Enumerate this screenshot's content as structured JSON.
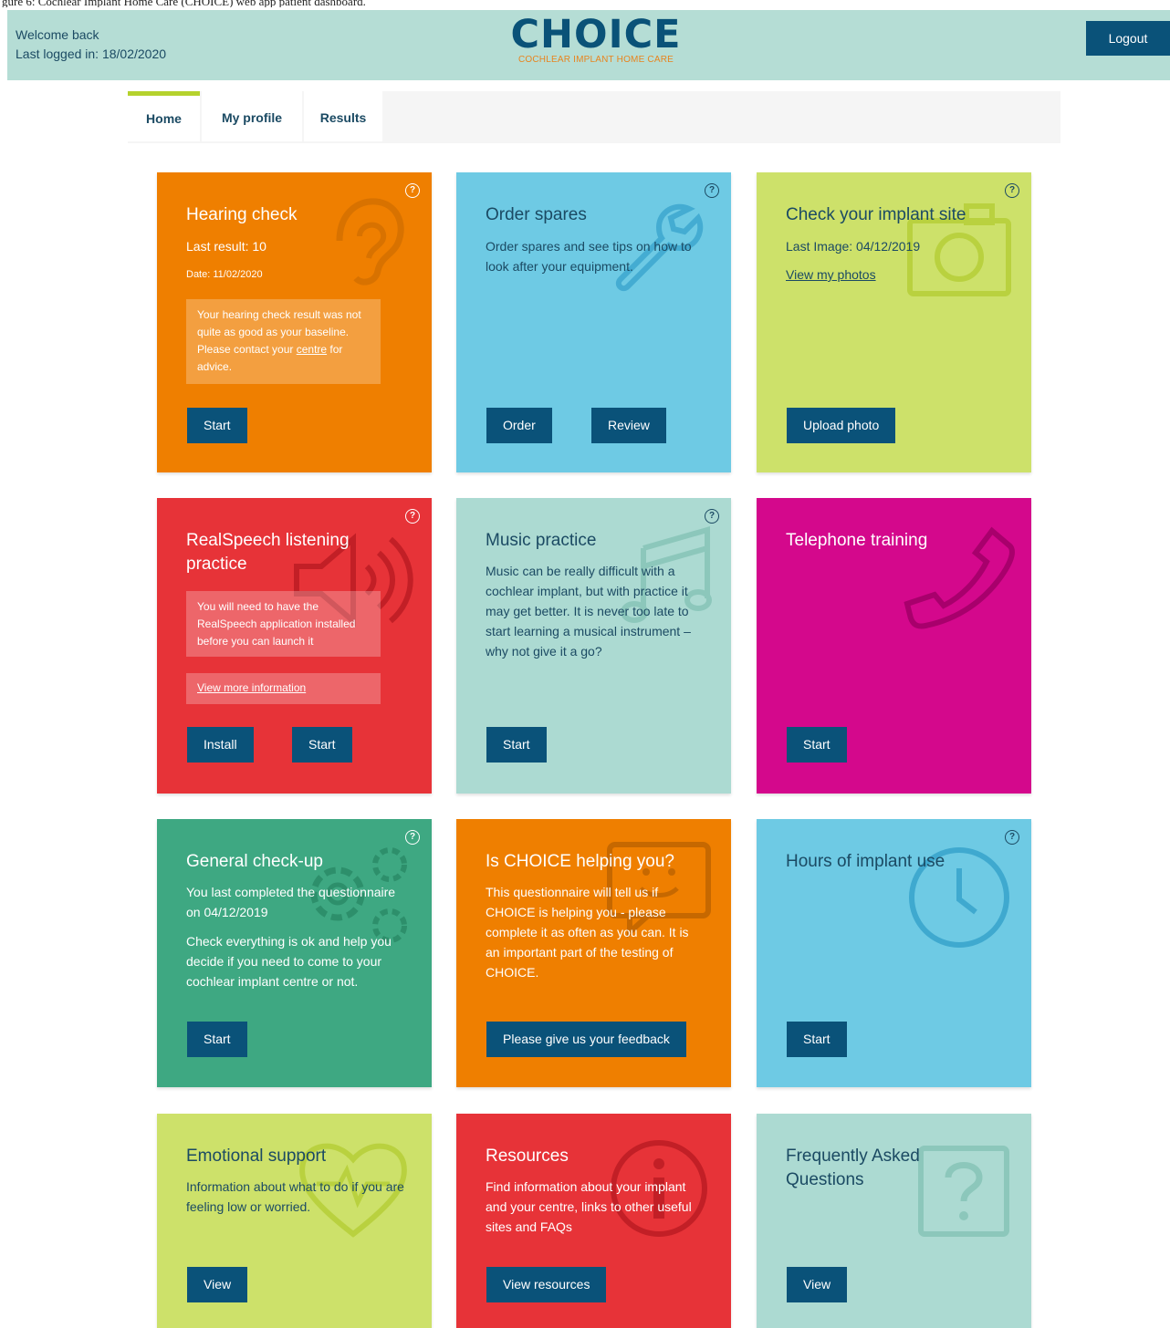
{
  "top_caption": "gure 6: Cochlear Implant Home Care (CHOICE) web app patient dashboard.",
  "header": {
    "welcome": "Welcome back",
    "last_login": "Last logged in: 18/02/2020",
    "logo_word": "CHOICE",
    "logo_sub": "COCHLEAR IMPLANT HOME CARE",
    "logout": "Logout"
  },
  "tabs": [
    {
      "label": "Home",
      "active": true
    },
    {
      "label": "My profile",
      "active": false
    },
    {
      "label": "Results",
      "active": false
    }
  ],
  "colors": {
    "orange": "#ef7f00",
    "sky": "#6ecae4",
    "lime": "#cde16a",
    "red": "#e73338",
    "mint": "#acdad2",
    "magenta": "#d4088c",
    "green": "#3ea882",
    "navy_button": "#0a5279"
  },
  "cards": {
    "hearing": {
      "title": "Hearing check",
      "last_result": "Last result: 10",
      "date": "Date: 11/02/2020",
      "note_pre": "Your hearing check result was not quite as good as your baseline. Please contact your ",
      "note_link": "centre",
      "note_post": " for advice.",
      "start": "Start",
      "icon": "ear-icon"
    },
    "spares": {
      "title": "Order spares",
      "text": "Order spares and see tips on how to look after your equipment.",
      "order": "Order",
      "review": "Review",
      "icon": "wrench-icon"
    },
    "implant_site": {
      "title": "Check your implant site",
      "last_image": "Last Image: 04/12/2019",
      "view_photos": "View my photos",
      "upload": "Upload photo",
      "icon": "camera-icon"
    },
    "realspeech": {
      "title": "RealSpeech listening practice",
      "note": "You will need to have the RealSpeech application installed before you can launch it",
      "more_info": "View more information",
      "install": "Install",
      "start": "Start",
      "icon": "speaker-icon"
    },
    "music": {
      "title": "Music practice",
      "text": "Music can be really difficult with a cochlear implant, but with practice it may get better. It is never too late to start learning a musical instrument – why not give it a go?",
      "start": "Start",
      "icon": "music-note-icon"
    },
    "telephone": {
      "title": "Telephone training",
      "start": "Start",
      "icon": "phone-icon"
    },
    "checkup": {
      "title": "General check-up",
      "last_completed": "You last completed the questionnaire on 04/12/2019",
      "text": "Check everything is ok and help you decide if you need to come to your cochlear implant centre or not.",
      "start": "Start",
      "icon": "gears-icon"
    },
    "helping": {
      "title": "Is CHOICE helping you?",
      "text": "This questionnaire will tell us if CHOICE is helping you - please complete it as often as you can. It is an important part of the testing of CHOICE.",
      "feedback": "Please give us your feedback",
      "icon": "smiley-chat-icon"
    },
    "hours": {
      "title": "Hours of implant use",
      "start": "Start",
      "icon": "clock-icon"
    },
    "emotional": {
      "title": "Emotional support",
      "text": "Information about what to do if you are feeling low or worried.",
      "view": "View",
      "icon": "heart-pulse-icon"
    },
    "resources": {
      "title": "Resources",
      "text": "Find information about your implant and your centre, links to other useful sites and FAQs",
      "view": "View resources",
      "icon": "info-icon"
    },
    "faq": {
      "title": "Frequently Asked Questions",
      "view": "View",
      "icon": "question-box-icon"
    }
  },
  "help_glyph": "?"
}
